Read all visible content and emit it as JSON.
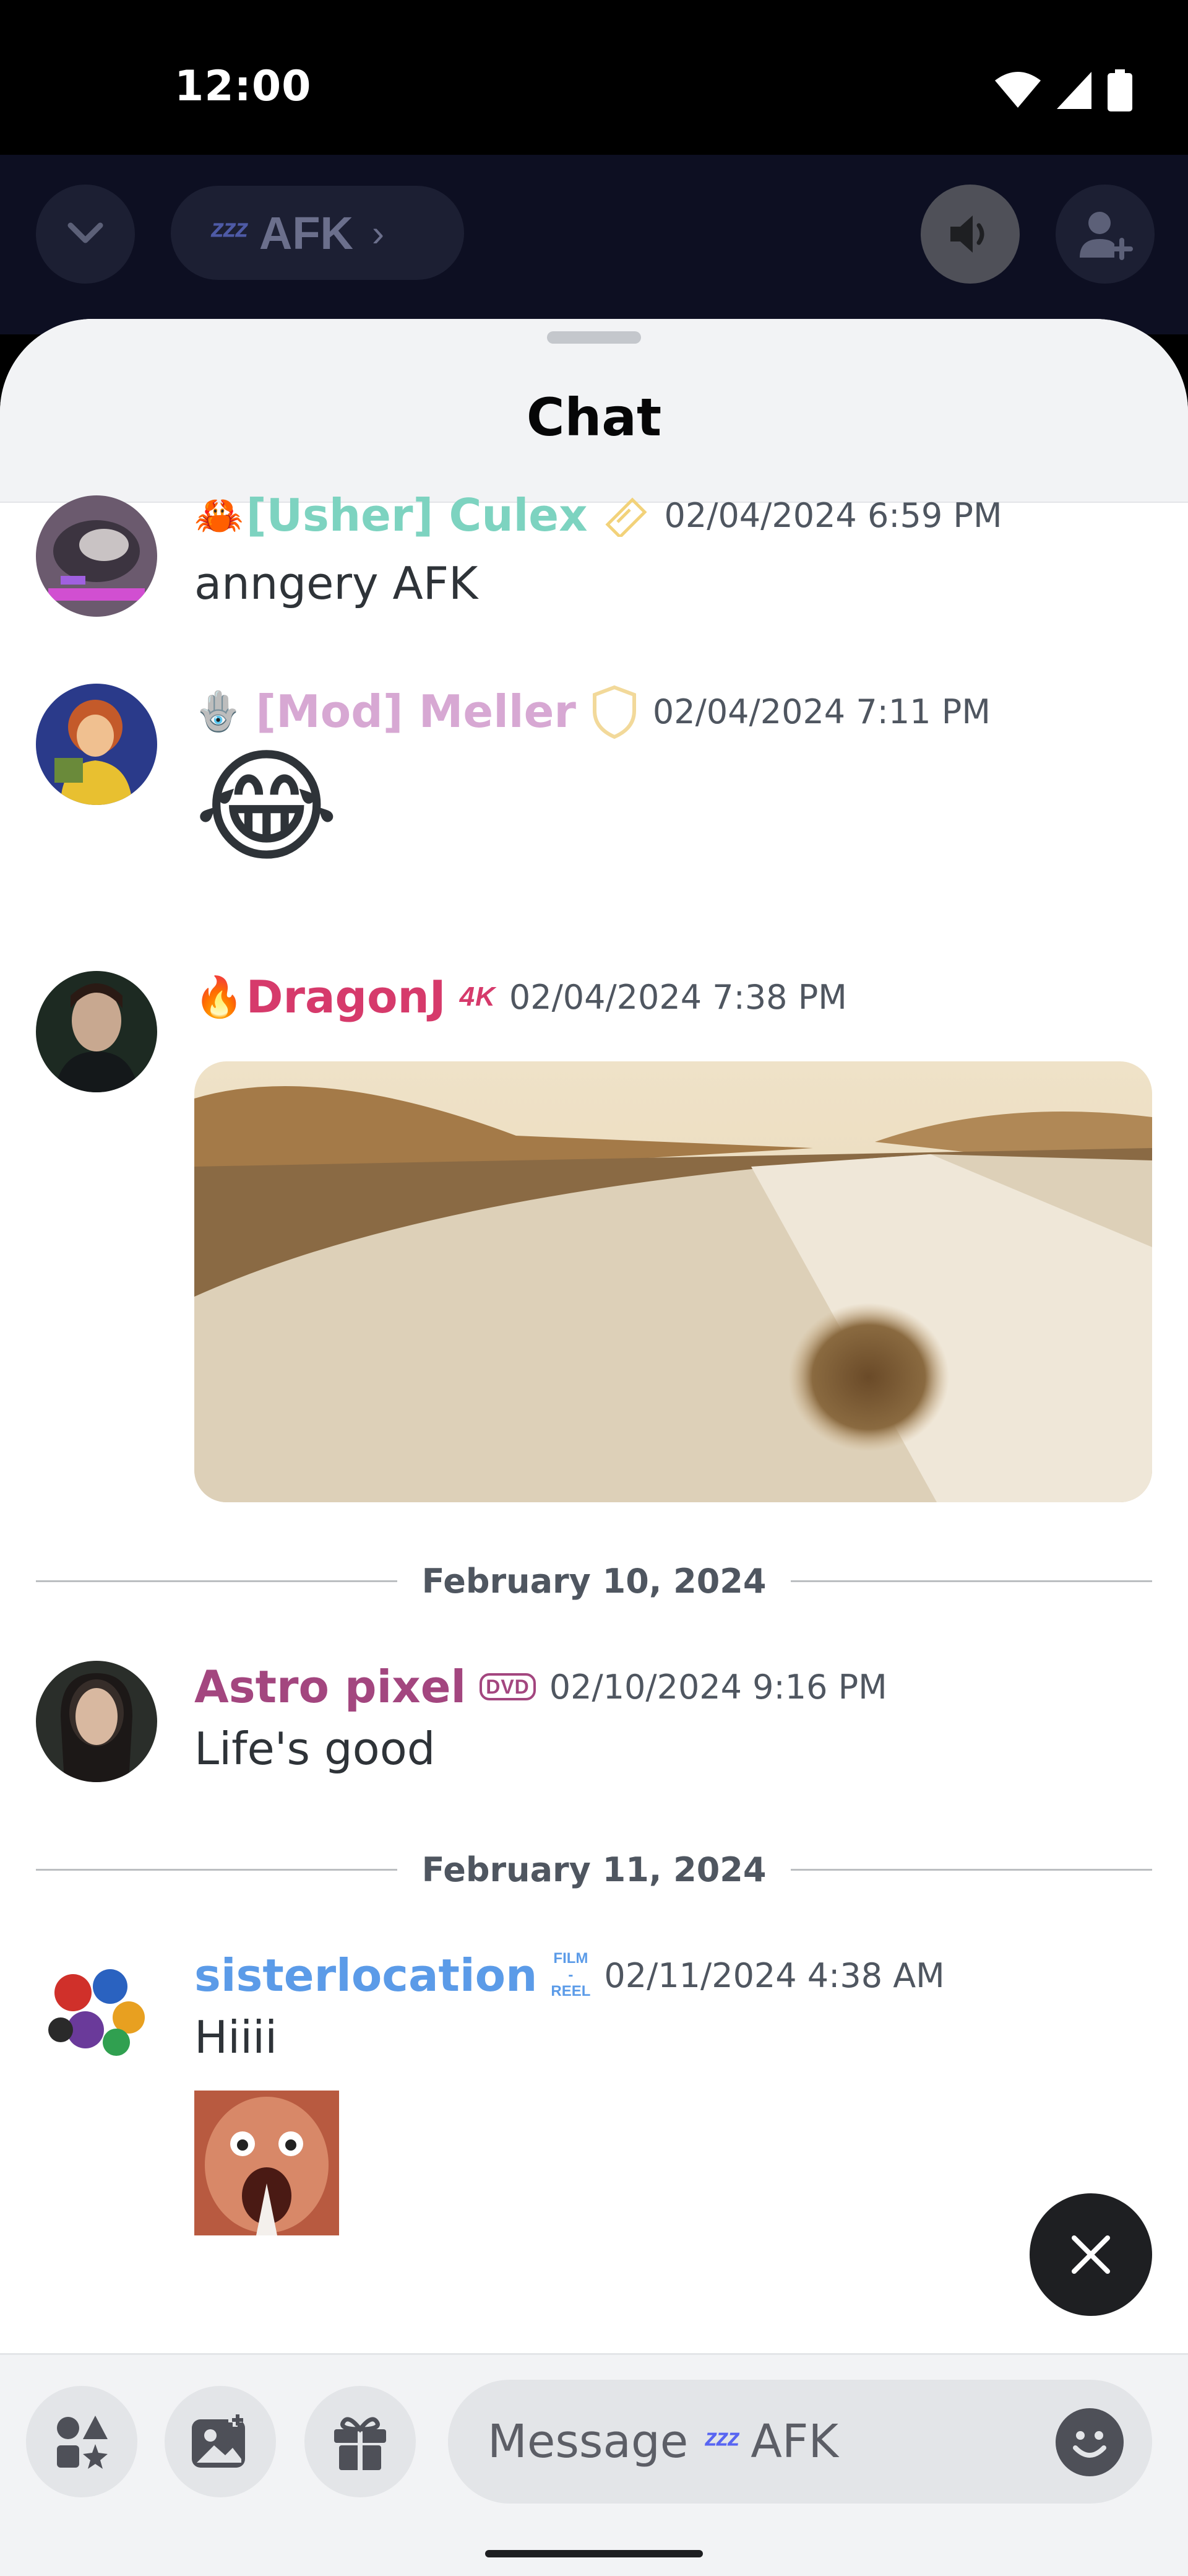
{
  "status_bar": {
    "time": "12:00"
  },
  "voice_header": {
    "channel_icon": "zzz",
    "channel_name": "AFK"
  },
  "sheet": {
    "title": "Chat"
  },
  "messages": [
    {
      "username": "[Usher] Culex",
      "prefix_emoji": "🦀",
      "timestamp": "02/04/2024 6:59 PM",
      "text": "anngery AFK",
      "color": "#7dd3c0"
    },
    {
      "username": "[Mod] Meller",
      "prefix_emoji": "🪬",
      "timestamp": "02/04/2024 7:11 PM",
      "text": "😂",
      "color": "#d7a8d3"
    },
    {
      "username": "DragonJ",
      "prefix_emoji": "🔥",
      "badge": "4K",
      "timestamp": "02/04/2024 7:38 PM",
      "color": "#d63a6b"
    },
    {
      "username": "Astro pixel",
      "badge": "DVD",
      "timestamp": "02/10/2024 9:16 PM",
      "text": "Life's good",
      "color": "#a3467f"
    },
    {
      "username": "sisterlocation",
      "badge_lines": [
        "FILM",
        "-",
        "REEL"
      ],
      "timestamp": "02/11/2024 4:38 AM",
      "text": "Hiiii",
      "color": "#5b9be8"
    }
  ],
  "dividers": [
    "February 10, 2024",
    "February 11, 2024"
  ],
  "composer": {
    "placeholder_prefix": "Message",
    "placeholder_icon": "zzz",
    "placeholder_channel": "AFK"
  },
  "colors": {
    "accent": "#5865f2",
    "background": "#ffffff",
    "header_dark": "#0d0f22"
  }
}
